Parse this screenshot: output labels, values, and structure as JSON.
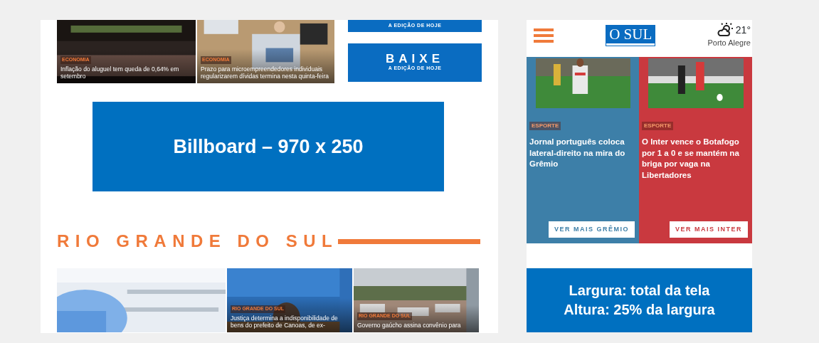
{
  "desktop": {
    "top_news": [
      {
        "category": "ECONOMIA",
        "title": "Inflação do aluguel tem queda de 0,64% em setembro"
      },
      {
        "category": "ECONOMIA",
        "title": "Prazo para microempreendedores individuais regularizarem dívidas termina nesta quinta-feira"
      }
    ],
    "banners": [
      {
        "subtitle": "A EDIÇÃO DE HOJE"
      },
      {
        "title": "BAIXE",
        "subtitle": "A EDIÇÃO DE HOJE"
      }
    ],
    "billboard": {
      "label": "Billboard – 970 x 250"
    },
    "section": {
      "title": "RIO GRANDE DO SUL"
    },
    "section_news": [
      {
        "kind": "picture"
      },
      {
        "category": "RIO GRANDE DO SUL",
        "title": "Justiça determina a indisponibilidade de bens do prefeito de Canoas, de ex-"
      },
      {
        "category": "RIO GRANDE DO SUL",
        "title": "Governo gaúcho assina convênio para"
      }
    ]
  },
  "mobile": {
    "header": {
      "logo": "O SUL",
      "temperature": "21°",
      "city": "Porto Alegre"
    },
    "columns": [
      {
        "color": "#3d7fa8",
        "category": "ESPORTE",
        "title": "Jornal português coloca lateral-direito na mira do Grêmio",
        "button": "VER MAIS GRÊMIO"
      },
      {
        "color": "#c9393f",
        "category": "ESPORTE",
        "title": "O Inter vence o Botafogo por 1 a 0 e se mantém na briga por vaga na Libertadores",
        "button": "VER MAIS INTER"
      }
    ]
  },
  "caption": {
    "lines": [
      "Largura: total da tela",
      "Altura: 25% da largura"
    ]
  }
}
